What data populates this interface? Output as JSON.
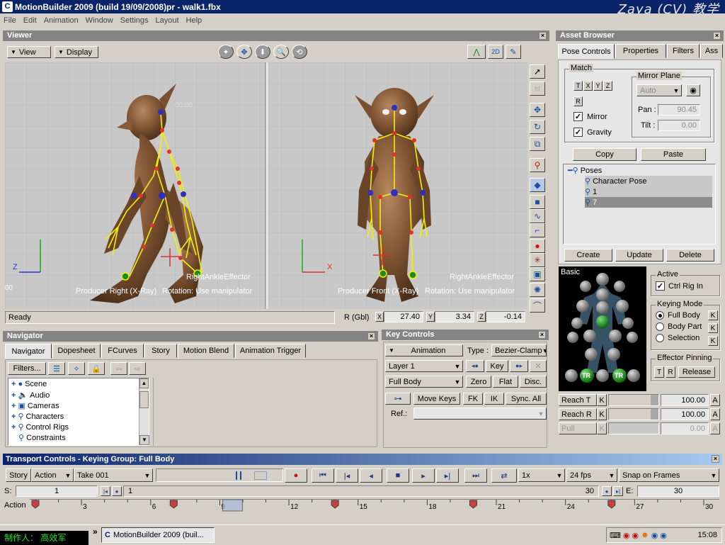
{
  "title": {
    "text": "MotionBuilder 2009   (build 19/09/2008)pr  - walk1.fbx",
    "watermark": "Zaya (CV) 教学"
  },
  "menu": [
    "File",
    "Edit",
    "Animation",
    "Window",
    "Settings",
    "Layout",
    "Help"
  ],
  "viewer": {
    "title": "Viewer",
    "view_label": "View",
    "display_label": "Display",
    "left_pane": {
      "producer": "Producer Right (X-Ray)",
      "rotation": "Rotation: Use manipulator",
      "effector": "RightAnkleEffector",
      "axis_a": "Z",
      "grid_label": "00"
    },
    "right_pane": {
      "producer": "Producer Front (X-Ray)",
      "rotation": "Rotation: Use manipulator",
      "effector": "RightAnkleEffector",
      "axis_a": "X"
    },
    "ghost_coord": "00.00",
    "status": "Ready",
    "rgbl_label": "R (Gbl)",
    "rx": "27.40",
    "ry": "3.34",
    "rz": "-0.14",
    "rx_axis": "X",
    "ry_axis": "Y",
    "rz_axis": "Z"
  },
  "asset_browser": {
    "title": "Asset Browser",
    "tabs": [
      "Pose Controls",
      "Properties",
      "Filters",
      "Ass"
    ],
    "match_label": "Match",
    "match_t": "T",
    "match_x": "X",
    "match_y": "Y",
    "match_z": "Z",
    "match_r": "R",
    "mirror_label": "Mirror",
    "gravity_label": "Gravity",
    "mirror_plane_label": "Mirror Plane",
    "mirror_plane_value": "Auto",
    "pan_label": "Pan :",
    "pan_value": "90.45",
    "tilt_label": "Tilt :",
    "tilt_value": "0.00",
    "copy_label": "Copy",
    "paste_label": "Paste",
    "tree_root": "Poses",
    "tree_items": [
      "Character Pose",
      "1",
      "7"
    ],
    "create_label": "Create",
    "update_label": "Update",
    "delete_label": "Delete"
  },
  "character_controls": {
    "basic_label": "Basic",
    "tr_label": "TR",
    "active_label": "Active",
    "ctrl_rig_label": "Ctrl Rig In",
    "keying_mode_label": "Keying Mode",
    "modes": [
      "Full Body",
      "Body Part",
      "Selection"
    ],
    "k_label": "K",
    "effector_pinning_label": "Effector Pinning",
    "pin_t": "T",
    "pin_r": "R",
    "release_label": "Release",
    "reach_t_label": "Reach T",
    "reach_t_value": "100.00",
    "reach_r_label": "Reach R",
    "reach_r_value": "100.00",
    "pull_label": "Pull",
    "pull_value": "0.00",
    "a_label": "A",
    "reach_t_fill": 0.84,
    "reach_r_fill": 0.84,
    "pull_fill": 0.0
  },
  "navigator": {
    "title": "Navigator",
    "tabs": [
      "Navigator",
      "Dopesheet",
      "FCurves",
      "Story",
      "Motion Blend",
      "Animation Trigger"
    ],
    "filters_label": "Filters...",
    "tree": [
      "Scene",
      "Audio",
      "Cameras",
      "Characters",
      "Control Rigs",
      "Constraints"
    ]
  },
  "key_controls": {
    "title": "Key Controls",
    "animation_label": "Animation",
    "type_label": "Type :",
    "type_value": "Bezier-Clamp",
    "layer_value": "Layer  1",
    "key_label": "Key",
    "body_value": "Full Body",
    "zero_label": "Zero",
    "flat_label": "Flat",
    "disc_label": "Disc.",
    "move_keys_label": "Move Keys",
    "fk_label": "FK",
    "ik_label": "IK",
    "sync_label": "Sync. All",
    "ref_label": "Ref.:"
  },
  "transport": {
    "title": "Transport Controls  -  Keying Group: Full Body",
    "story_label": "Story",
    "action_value": "Action",
    "take_value": "Take 001",
    "speed_value": "1x",
    "fps_value": "24 fps",
    "snap_value": "Snap on Frames",
    "s_label": "S:",
    "s_value": "1",
    "range_start": "1",
    "range_end": "30",
    "e_label": "E:",
    "e_value": "30",
    "timeline_label": "Action",
    "ticks": [
      "3",
      "6",
      "9",
      "12",
      "15",
      "18",
      "21",
      "24",
      "27",
      "30"
    ]
  },
  "taskbar": {
    "task_label": "MotionBuilder 2009   (buil...",
    "clock": "15:08",
    "creator": "制作人：  高效军",
    "chevron": "»"
  }
}
